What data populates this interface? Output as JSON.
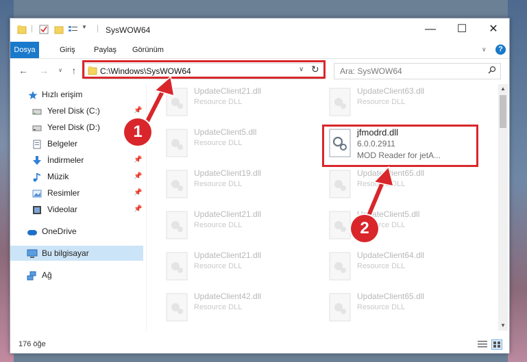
{
  "window": {
    "title": "SysWOW64",
    "controls": {
      "minimize": "—",
      "maximize": "☐",
      "close": "✕"
    }
  },
  "ribbon": {
    "tabs": [
      "Dosya",
      "Giriş",
      "Paylaş",
      "Görünüm"
    ]
  },
  "address": {
    "path": "C:\\Windows\\SysWOW64",
    "search_placeholder": "Ara: SysWOW64"
  },
  "sidebar": {
    "items": [
      {
        "label": "Hızlı erişim",
        "icon": "star-icon"
      },
      {
        "label": "Yerel Disk (C:)",
        "icon": "drive-icon",
        "pinned": true
      },
      {
        "label": "Yerel Disk (D:)",
        "icon": "drive-icon",
        "pinned": true
      },
      {
        "label": "Belgeler",
        "icon": "documents-icon",
        "pinned": true
      },
      {
        "label": "İndirmeler",
        "icon": "download-icon",
        "pinned": true
      },
      {
        "label": "Müzik",
        "icon": "music-icon",
        "pinned": true
      },
      {
        "label": "Resimler",
        "icon": "pictures-icon",
        "pinned": true
      },
      {
        "label": "Videolar",
        "icon": "videos-icon",
        "pinned": true
      },
      {
        "label": "OneDrive",
        "icon": "cloud-icon"
      },
      {
        "label": "Bu bilgisayar",
        "icon": "computer-icon",
        "selected": true
      },
      {
        "label": "Ağ",
        "icon": "network-icon"
      }
    ]
  },
  "files": {
    "left": [
      {
        "name": "UpdateClient21.dll",
        "desc": "Resource DLL"
      },
      {
        "name": "UpdateClient5.dll",
        "desc": "Resource DLL"
      },
      {
        "name": "UpdateClient19.dll",
        "desc": "Resource DLL"
      },
      {
        "name": "UpdateClient21.dll",
        "desc": "Resource DLL"
      },
      {
        "name": "UpdateClient21.dll",
        "desc": "Resource DLL"
      },
      {
        "name": "UpdateClient42.dll",
        "desc": "Resource DLL"
      }
    ],
    "right": [
      {
        "name": "UpdateClient63.dll",
        "desc": "Resource DLL"
      },
      {
        "name": "jfmodrd.dll",
        "version": "6.0.0.2911",
        "desc": "MOD Reader for jetA...",
        "highlight": true
      },
      {
        "name": "UpdateClient65.dll",
        "desc": "Resource DLL"
      },
      {
        "name": "UpdateClient5.dll",
        "desc": "Resource DLL"
      },
      {
        "name": "UpdateClient64.dll",
        "desc": "Resource DLL"
      },
      {
        "name": "UpdateClient65.dll",
        "desc": "Resource DLL"
      }
    ]
  },
  "status": {
    "count": "176 öğe"
  },
  "annotations": {
    "badge1": "1",
    "badge2": "2",
    "color": "#d9262b"
  }
}
